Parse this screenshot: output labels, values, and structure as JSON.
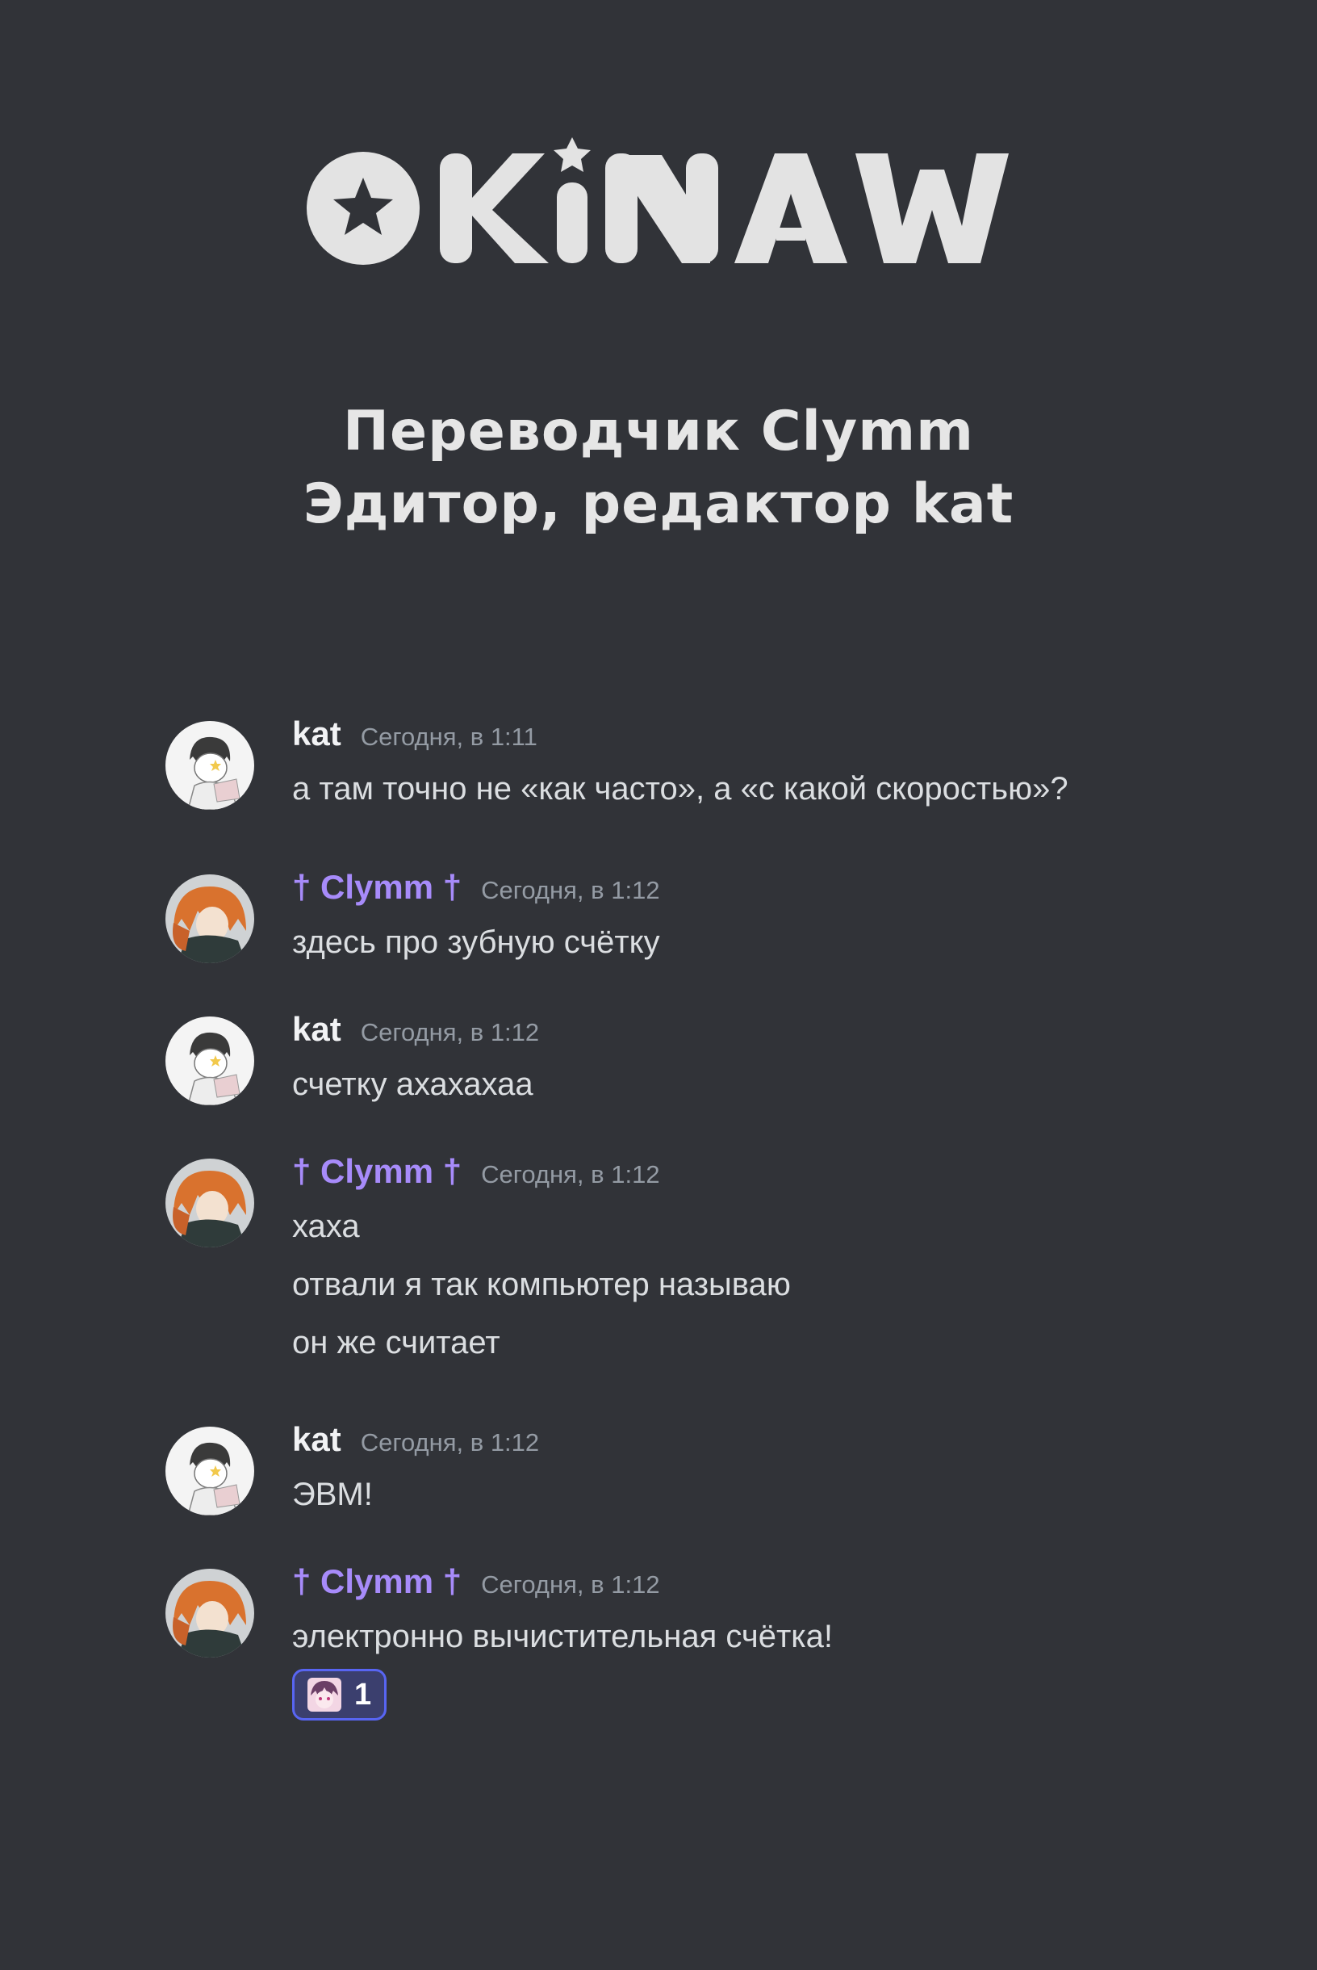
{
  "logo": {
    "text": "OKiNAWA"
  },
  "credits": {
    "translator": "Переводчик Clymm",
    "editor": "Эдитор, редактор kat"
  },
  "colors": {
    "background": "#313338",
    "clymm_name": "#a78bfa",
    "kat_name": "#f2f3f5",
    "timestamp": "#949ba4",
    "reaction_border": "#5865f2"
  },
  "messages": [
    {
      "author": "kat",
      "avatar": "kat-avatar",
      "time": "Сегодня, в 1:11",
      "lines": [
        "а там точно не «как часто», а «с какой скоростью»?"
      ]
    },
    {
      "author": "† Clymm †",
      "avatar": "clymm-avatar",
      "time": "Сегодня, в 1:12",
      "lines": [
        "здесь про зубную счётку"
      ]
    },
    {
      "author": "kat",
      "avatar": "kat-avatar",
      "time": "Сегодня, в 1:12",
      "lines": [
        "счетку ахахахаа"
      ]
    },
    {
      "author": "† Clymm †",
      "avatar": "clymm-avatar",
      "time": "Сегодня, в 1:12",
      "lines": [
        "хаха",
        "отвали я так компьютер называю",
        "он же считает"
      ]
    },
    {
      "author": "kat",
      "avatar": "kat-avatar",
      "time": "Сегодня, в 1:12",
      "lines": [
        "ЭВМ!"
      ]
    },
    {
      "author": "† Clymm †",
      "avatar": "clymm-avatar",
      "time": "Сегодня, в 1:12",
      "lines": [
        "электронно вычистительная счётка!"
      ],
      "reaction": {
        "emoji": "anime-girl-emoji",
        "count": "1"
      }
    }
  ]
}
